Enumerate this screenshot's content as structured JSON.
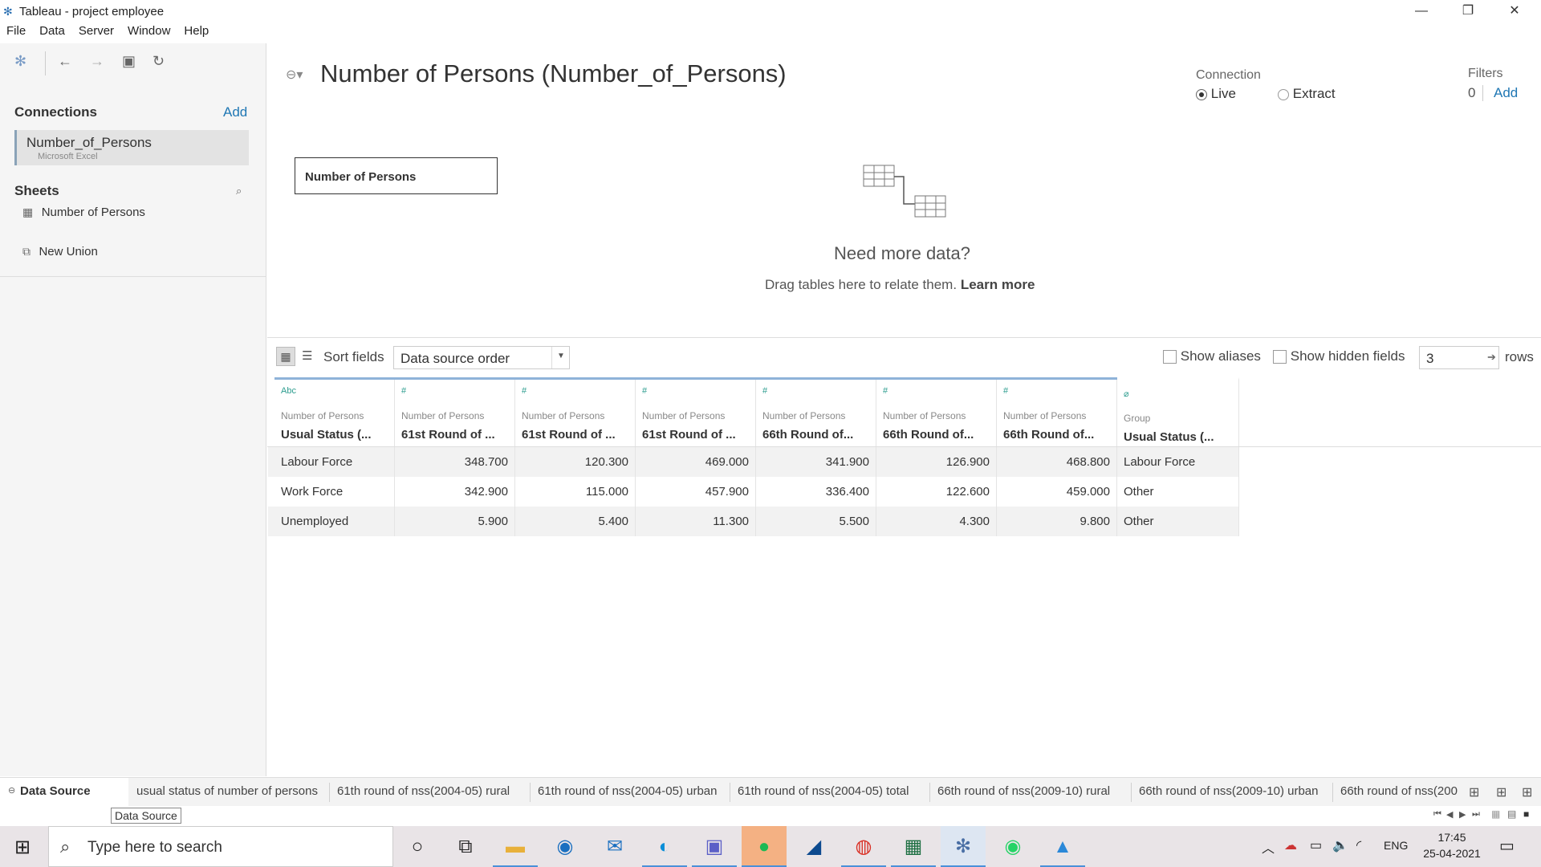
{
  "window": {
    "title": "Tableau - project employee"
  },
  "menu": [
    "File",
    "Data",
    "Server",
    "Window",
    "Help"
  ],
  "left": {
    "connections_label": "Connections",
    "add_label": "Add",
    "connection": {
      "name": "Number_of_Persons",
      "type": "Microsoft Excel"
    },
    "sheets_label": "Sheets",
    "sheets": [
      "Number of Persons",
      "New Union"
    ]
  },
  "main": {
    "title": "Number of Persons (Number_of_Persons)",
    "connection_label": "Connection",
    "live_label": "Live",
    "extract_label": "Extract",
    "filters_label": "Filters",
    "filters_count": "0",
    "filters_add": "Add",
    "table_box": "Number of Persons",
    "need_more": "Need more data?",
    "drag_text": "Drag tables here to relate them.",
    "learn_more": "Learn more"
  },
  "grid_toolbar": {
    "sort_label": "Sort fields",
    "sort_value": "Data source order",
    "show_aliases": "Show aliases",
    "show_hidden": "Show hidden fields",
    "rows_value": "3",
    "rows_label": "rows"
  },
  "grid": {
    "columns": [
      {
        "type": "Abc",
        "source": "Number of Persons",
        "name": "Usual Status (..."
      },
      {
        "type": "#",
        "source": "Number of Persons",
        "name": "61st Round of ..."
      },
      {
        "type": "#",
        "source": "Number of Persons",
        "name": "61st Round of ..."
      },
      {
        "type": "#",
        "source": "Number of Persons",
        "name": "61st Round of ..."
      },
      {
        "type": "#",
        "source": "Number of Persons",
        "name": "66th Round of..."
      },
      {
        "type": "#",
        "source": "Number of Persons",
        "name": "66th Round of..."
      },
      {
        "type": "#",
        "source": "Number of Persons",
        "name": "66th Round of..."
      },
      {
        "type": "⌀",
        "source": "Group",
        "name": "Usual Status (..."
      }
    ],
    "rows": [
      [
        "Labour Force",
        "348.700",
        "120.300",
        "469.000",
        "341.900",
        "126.900",
        "468.800",
        "Labour Force"
      ],
      [
        "Work Force",
        "342.900",
        "115.000",
        "457.900",
        "336.400",
        "122.600",
        "459.000",
        "Other"
      ],
      [
        "Unemployed",
        "5.900",
        "5.400",
        "11.300",
        "5.500",
        "4.300",
        "9.800",
        "Other"
      ]
    ]
  },
  "tabs": {
    "data_source": "Data Source",
    "sheets": [
      "usual status of number of persons",
      "61th round of nss(2004-05) rural",
      "61th round of nss(2004-05) urban",
      "61th round of nss(2004-05) total",
      "66th round of nss(2009-10) rural",
      "66th round of nss(2009-10) urban",
      "66th round of nss(200"
    ],
    "tooltip": "Data Source"
  },
  "taskbar": {
    "search_placeholder": "Type here to search",
    "lang": "ENG",
    "time": "17:45",
    "date": "25-04-2021",
    "apps": [
      "cortana-icon",
      "task-view-icon",
      "file-explorer-icon",
      "dell-icon",
      "mail-icon",
      "edge-icon",
      "teams-icon",
      "spotify-icon",
      "app-icon",
      "chrome-icon",
      "excel-icon",
      "tableau-icon",
      "whatsapp-icon",
      "photos-icon"
    ]
  },
  "colors": {
    "accent": "#1f77b4",
    "teal": "#2b9c8e",
    "grid_top": "#8fb3d9"
  }
}
